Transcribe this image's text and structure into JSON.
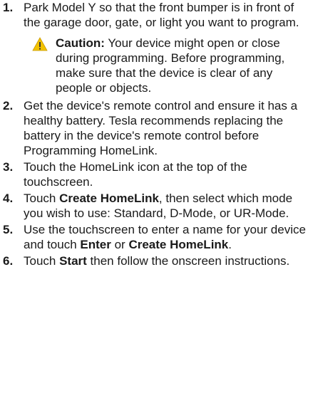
{
  "steps": [
    {
      "num": "1.",
      "text": "Park Model Y so that the front bumper is in front of the garage door, gate, or light you want to program.",
      "caution": {
        "label": "Caution:",
        "text": " Your device might open or close during programming. Before programming, make sure that the device is clear of any people or objects."
      }
    },
    {
      "num": "2.",
      "text": "Get the device's remote control and ensure it has a healthy battery. Tesla recommends replacing the battery in the device's remote control before Programming HomeLink."
    },
    {
      "num": "3.",
      "text": "Touch the HomeLink icon at the top of the touchscreen."
    },
    {
      "num": "4.",
      "pre": "Touch ",
      "strong1": "Create HomeLink",
      "post": ", then select which mode you wish to use: Standard, D-Mode, or UR-Mode."
    },
    {
      "num": "5.",
      "pre": "Use the touchscreen to enter a name for your device and touch ",
      "strong1": "Enter",
      "mid": " or ",
      "strong2": "Create HomeLink",
      "post": "."
    },
    {
      "num": "6.",
      "pre": "Touch ",
      "strong1": "Start",
      "post": " then follow the onscreen instructions."
    }
  ],
  "colors": {
    "caution_icon_fill": "#f2c200",
    "caution_icon_mark": "#3a3a3a",
    "text": "#1a1a1a"
  },
  "icons": {
    "caution": "warning-triangle-icon"
  }
}
